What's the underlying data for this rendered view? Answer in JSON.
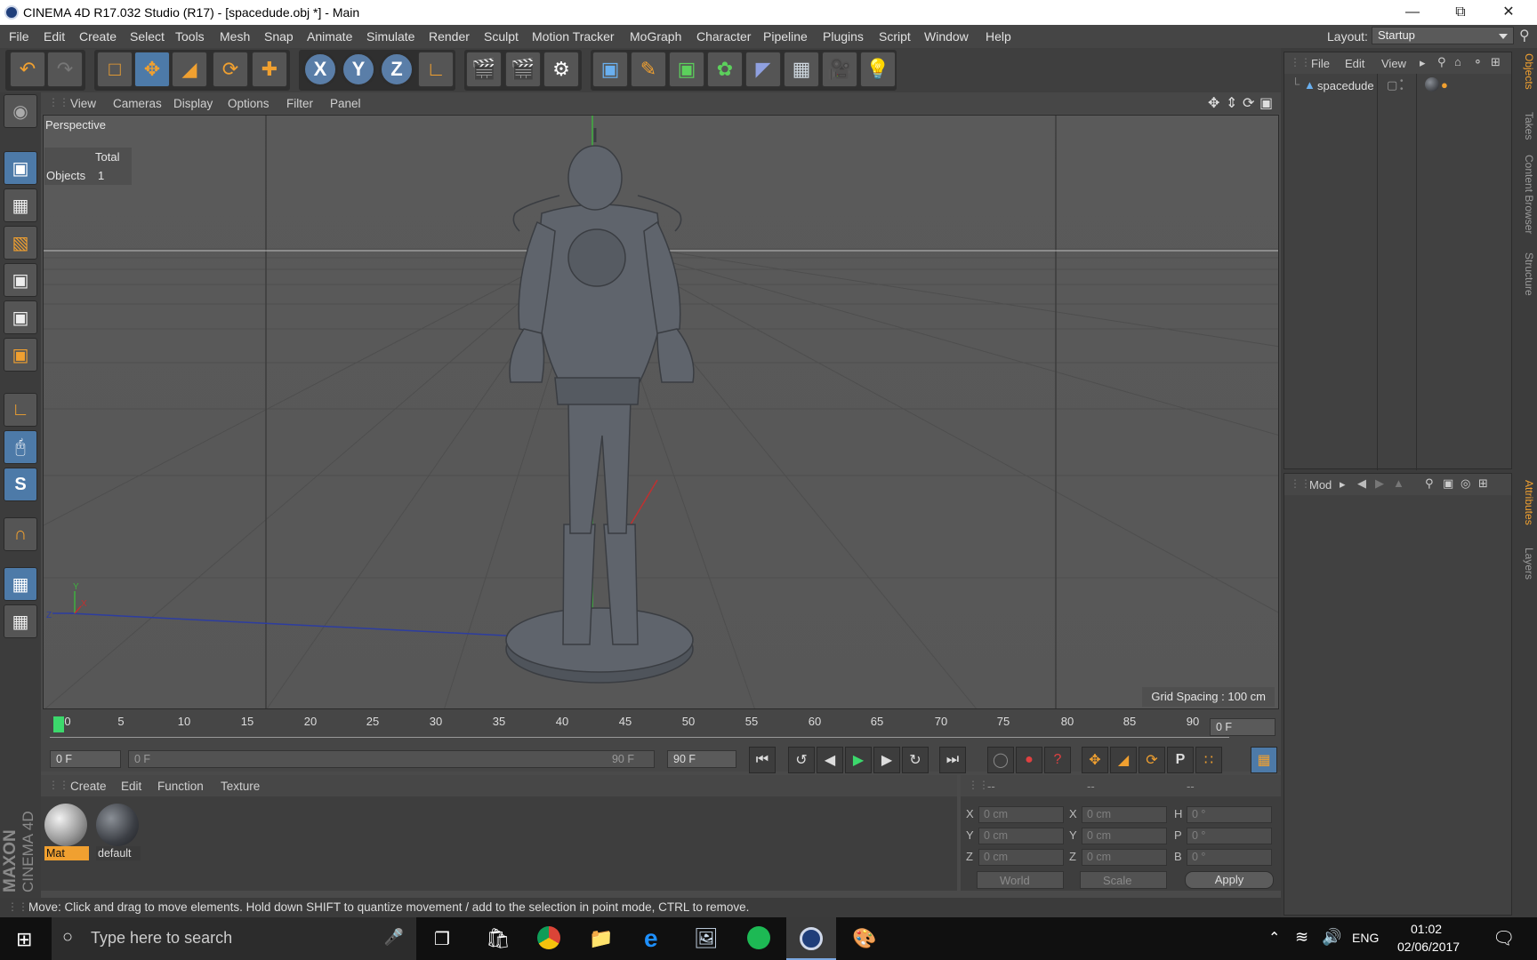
{
  "window": {
    "title": "CINEMA 4D R17.032 Studio (R17) - [spacedude.obj *] - Main"
  },
  "menubar": {
    "items": [
      "File",
      "Edit",
      "Create",
      "Select",
      "Tools",
      "Mesh",
      "Snap",
      "Animate",
      "Simulate",
      "Render",
      "Sculpt",
      "Motion Tracker",
      "MoGraph",
      "Character",
      "Pipeline",
      "Plugins",
      "Script",
      "Window",
      "Help"
    ],
    "layout_label": "Layout:",
    "layout_value": "Startup"
  },
  "viewport": {
    "menu": [
      "View",
      "Cameras",
      "Display",
      "Options",
      "Filter",
      "Panel"
    ],
    "camera_label": "Perspective",
    "stats_header": "Total",
    "stats_label": "Objects",
    "stats_value": "1",
    "grid_spacing": "Grid Spacing : 100 cm"
  },
  "timeline": {
    "ticks": [
      "0",
      "5",
      "10",
      "15",
      "20",
      "25",
      "30",
      "35",
      "40",
      "45",
      "50",
      "55",
      "60",
      "65",
      "70",
      "75",
      "80",
      "85",
      "90"
    ],
    "current_frame": "0 F",
    "start_frame": "0 F",
    "range_start": "0 F",
    "range_end": "90 F",
    "end_frame": "90 F"
  },
  "materials": {
    "menu": [
      "Create",
      "Edit",
      "Function",
      "Texture"
    ],
    "items": [
      {
        "name": "Mat",
        "selected": true
      },
      {
        "name": "default",
        "selected": false
      }
    ]
  },
  "coordinates": {
    "headers": [
      "--",
      "--",
      "--"
    ],
    "rows": [
      {
        "l1": "X",
        "v1": "0 cm",
        "l2": "X",
        "v2": "0 cm",
        "l3": "H",
        "v3": "0 °"
      },
      {
        "l1": "Y",
        "v1": "0 cm",
        "l2": "Y",
        "v2": "0 cm",
        "l3": "P",
        "v3": "0 °"
      },
      {
        "l1": "Z",
        "v1": "0 cm",
        "l2": "Z",
        "v2": "0 cm",
        "l3": "B",
        "v3": "0 °"
      }
    ],
    "space": "World",
    "mode": "Scale",
    "apply_label": "Apply"
  },
  "status": {
    "text": "Move: Click and drag to move elements. Hold down SHIFT to quantize movement / add to the selection in point mode, CTRL to remove."
  },
  "objects_panel": {
    "menu": [
      "File",
      "Edit",
      "View"
    ],
    "objects": [
      "spacedude"
    ],
    "tabs": [
      "Objects",
      "Takes",
      "Content Browser",
      "Structure"
    ]
  },
  "attributes_panel": {
    "menu": [
      "Mod"
    ],
    "tabs": [
      "Attributes",
      "Layers"
    ]
  },
  "taskbar": {
    "search_placeholder": "Type here to search",
    "language": "ENG",
    "time": "01:02",
    "date": "02/06/2017"
  },
  "branding": {
    "maxon": "MAXON",
    "cinema": "CINEMA 4D"
  },
  "colors": {
    "accent_orange": "#f0a030",
    "active_blue": "#4d7aa8",
    "selected_material": "#f0a030"
  }
}
